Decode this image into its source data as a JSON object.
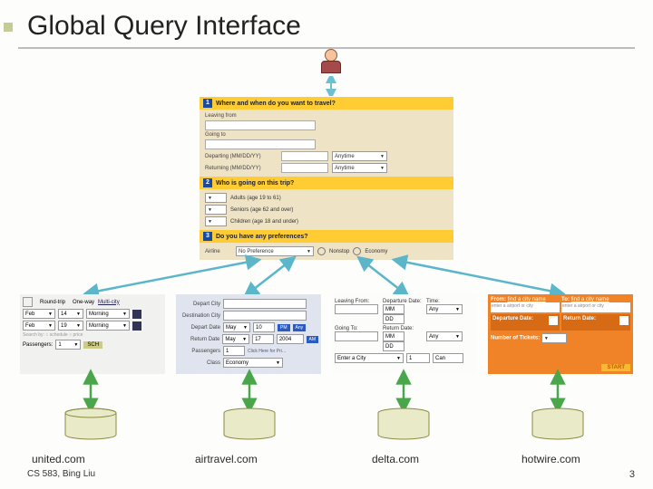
{
  "title": "Global Query Interface",
  "footer": "CS 583, Bing Liu",
  "page": "3",
  "gform": {
    "sec1": "Where and when do you want to travel?",
    "leaving_from": "Leaving from",
    "going_to": "Going to",
    "departing_lbl": "Departing (MM/DD/YY)",
    "returning_lbl": "Returning (MM/DD/YY)",
    "anytime": "Anytime",
    "sec2": "Who is going on this trip?",
    "adults": "Adults (age 19 to 61)",
    "seniors": "Seniors (age 62 and over)",
    "children": "Children (age 18 and under)",
    "sec3": "Do you have any preferences?",
    "airline": "Airline",
    "nopref": "No Preference",
    "nonstop_lbl": "Nonstop",
    "econ_lbl": "Economy"
  },
  "united": {
    "roundtrip": "Round-trip",
    "oneway": "One-way",
    "multi": "Multi-city",
    "feb": "Feb",
    "d14": "14",
    "morning": "Morning",
    "d19": "19",
    "pax_lbl": "Passengers:",
    "one": "1",
    "sch": "SCH"
  },
  "airtravel": {
    "depart_city": "Depart City",
    "dest_city": "Destination City",
    "depart_date": "Depart Date",
    "return_date": "Return Date",
    "may": "May",
    "d10": "10",
    "d17": "17",
    "yr": "2004",
    "am": "AM",
    "pm": "PM",
    "any": "Any",
    "pax": "Passengers",
    "class": "Class",
    "economy": "Economy",
    "click": "Click Here for Pri…"
  },
  "delta": {
    "leaving": "Leaving From:",
    "depdate": "Departure Date:",
    "time": "Time:",
    "MM": "MM",
    "DD": "DD",
    "anytime": "Any",
    "goingto": "Going To:",
    "retdate": "Return Date:",
    "ecity": "Enter a City",
    "cal": "—",
    "one": "1",
    "can": "Can"
  },
  "hotwire": {
    "from": "From:",
    "to": "To:",
    "find_from": "find a city name",
    "find_to": "find a city name",
    "placeholder": "enter a airport or city",
    "dep": "Departure Date:",
    "ret": "Return Date:",
    "tickets": "Number of Tickets:",
    "start": "START"
  },
  "sites": {
    "united": "united.com",
    "airtravel": "airtravel.com",
    "delta": "delta.com",
    "hotwire": "hotwire.com"
  }
}
